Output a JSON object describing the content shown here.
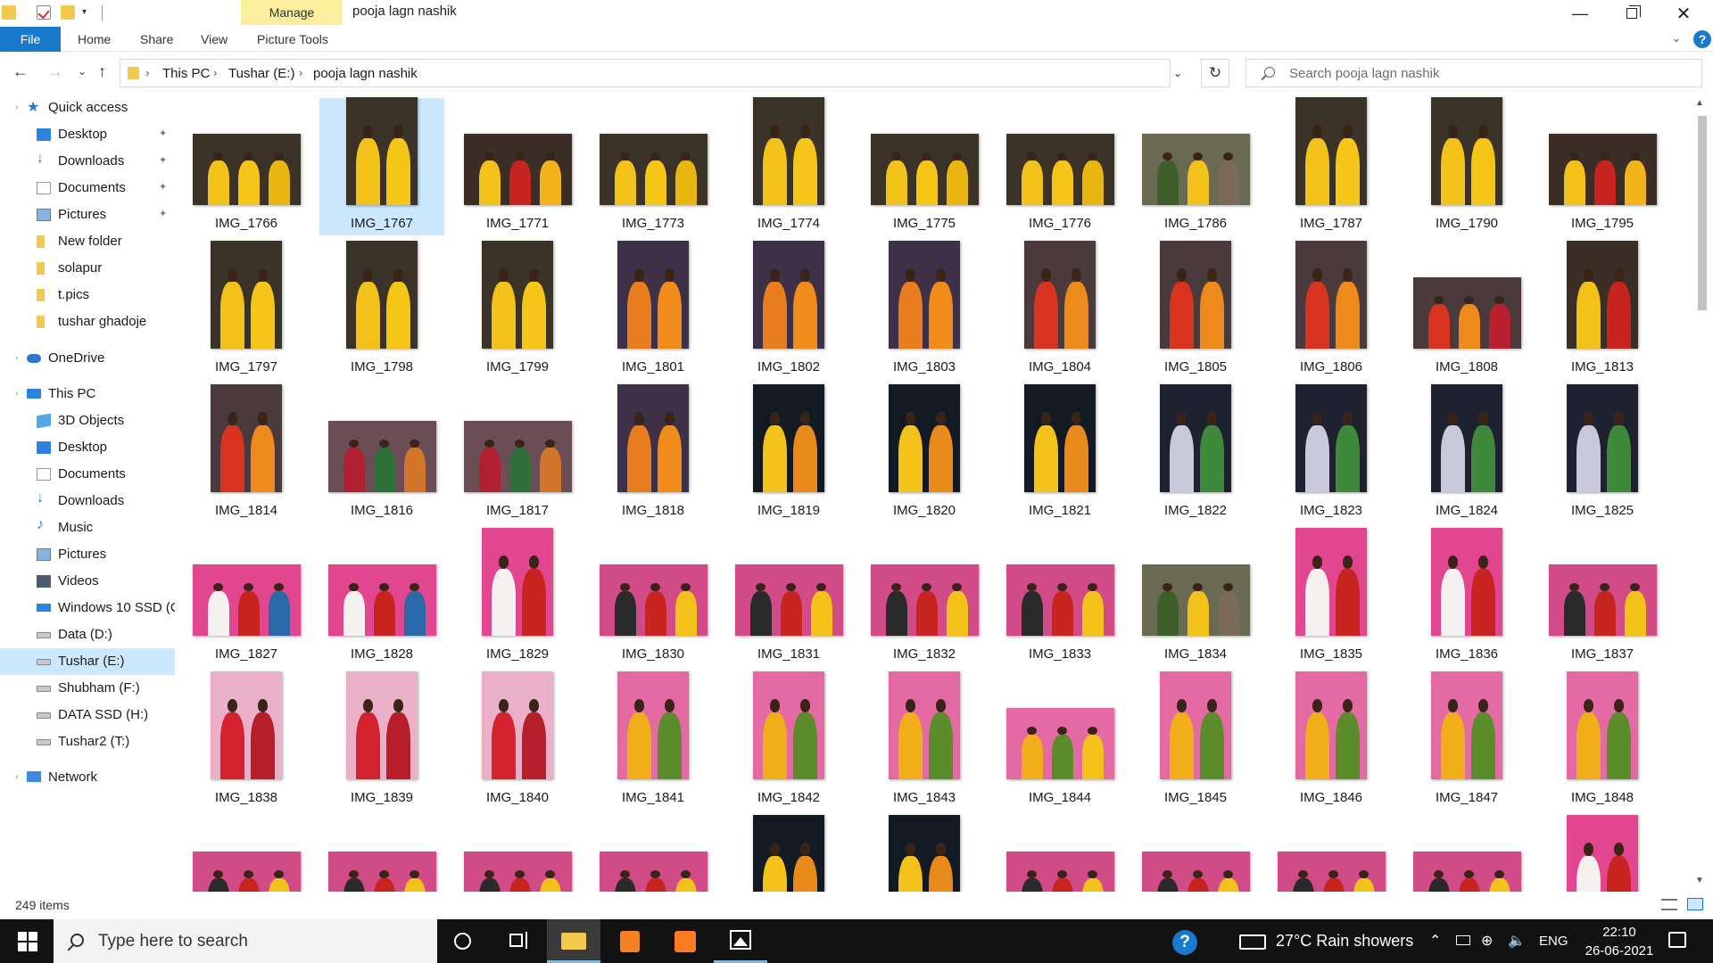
{
  "titlebar": {
    "title": "pooja lagn nashik",
    "manage_tab": "Manage",
    "dropdown_glyph": "▾",
    "minimize_glyph": "—",
    "close_glyph": "✕"
  },
  "ribbon": {
    "file": "File",
    "tabs": [
      "Home",
      "Share",
      "View",
      "Picture Tools"
    ],
    "expand_glyph": "⌄",
    "help_glyph": "?"
  },
  "nav": {
    "back_glyph": "←",
    "forward_glyph": "→",
    "recent_glyph": "⌄",
    "up_glyph": "↑",
    "breadcrumb_sep": "›",
    "breadcrumbs": [
      "This PC",
      "Tushar (E:)",
      "pooja lagn nashik"
    ],
    "dropdown_glyph": "⌄",
    "refresh_glyph": "↻",
    "search_placeholder": "Search pooja lagn nashik"
  },
  "sidebar": {
    "pin_glyph": "📌",
    "caret_glyph": "›",
    "items": [
      {
        "label": "Quick access",
        "icon": "star-icon"
      },
      {
        "label": "Desktop",
        "icon": "desktop-icon",
        "pinned": true
      },
      {
        "label": "Downloads",
        "icon": "download-icon",
        "pinned": true
      },
      {
        "label": "Documents",
        "icon": "documents-icon",
        "pinned": true
      },
      {
        "label": "Pictures",
        "icon": "pictures-icon",
        "pinned": true
      },
      {
        "label": "New folder",
        "icon": "folder-icon"
      },
      {
        "label": "solapur",
        "icon": "folder-icon"
      },
      {
        "label": "t.pics",
        "icon": "folder-icon"
      },
      {
        "label": "tushar ghadoje",
        "icon": "folder-icon"
      },
      {
        "label": "OneDrive",
        "icon": "cloud-icon"
      },
      {
        "label": "This PC",
        "icon": "computer-icon"
      },
      {
        "label": "3D Objects",
        "icon": "3d-objects-icon"
      },
      {
        "label": "Desktop",
        "icon": "desktop-icon"
      },
      {
        "label": "Documents",
        "icon": "documents-icon"
      },
      {
        "label": "Downloads",
        "icon": "download-icon"
      },
      {
        "label": "Music",
        "icon": "music-icon"
      },
      {
        "label": "Pictures",
        "icon": "pictures-icon"
      },
      {
        "label": "Videos",
        "icon": "videos-icon"
      },
      {
        "label": "Windows 10 SSD (C",
        "icon": "windows-drive-icon"
      },
      {
        "label": "Data (D:)",
        "icon": "drive-icon"
      },
      {
        "label": "Tushar (E:)",
        "icon": "drive-icon",
        "selected": true
      },
      {
        "label": "Shubham (F:)",
        "icon": "drive-icon"
      },
      {
        "label": "DATA SSD (H:)",
        "icon": "drive-icon"
      },
      {
        "label": "Tushar2 (T:)",
        "icon": "drive-icon"
      },
      {
        "label": "Network",
        "icon": "network-icon"
      }
    ]
  },
  "files": {
    "items": [
      {
        "name": "IMG_1766",
        "orient": "land",
        "scene": "yellow"
      },
      {
        "name": "IMG_1767",
        "orient": "port",
        "scene": "yellow",
        "selected": true
      },
      {
        "name": "IMG_1771",
        "orient": "land",
        "scene": "yellowred"
      },
      {
        "name": "IMG_1773",
        "orient": "land",
        "scene": "yellow"
      },
      {
        "name": "IMG_1774",
        "orient": "port",
        "scene": "yellow"
      },
      {
        "name": "IMG_1775",
        "orient": "land",
        "scene": "yellow"
      },
      {
        "name": "IMG_1776",
        "orient": "land",
        "scene": "yellow"
      },
      {
        "name": "IMG_1786",
        "orient": "land",
        "scene": "garden"
      },
      {
        "name": "IMG_1787",
        "orient": "port",
        "scene": "yellow"
      },
      {
        "name": "IMG_1790",
        "orient": "port",
        "scene": "yellow"
      },
      {
        "name": "IMG_1795",
        "orient": "land",
        "scene": "yellowred"
      },
      {
        "name": "IMG_1797",
        "orient": "port",
        "scene": "yellow"
      },
      {
        "name": "IMG_1798",
        "orient": "port",
        "scene": "yellow"
      },
      {
        "name": "IMG_1799",
        "orient": "port",
        "scene": "yellow"
      },
      {
        "name": "IMG_1801",
        "orient": "port",
        "scene": "orange"
      },
      {
        "name": "IMG_1802",
        "orient": "port",
        "scene": "orange"
      },
      {
        "name": "IMG_1803",
        "orient": "port",
        "scene": "orange"
      },
      {
        "name": "IMG_1804",
        "orient": "port",
        "scene": "orangered"
      },
      {
        "name": "IMG_1805",
        "orient": "port",
        "scene": "orangered"
      },
      {
        "name": "IMG_1806",
        "orient": "port",
        "scene": "orangered"
      },
      {
        "name": "IMG_1808",
        "orient": "land",
        "scene": "orangered"
      },
      {
        "name": "IMG_1813",
        "orient": "port",
        "scene": "yellowred"
      },
      {
        "name": "IMG_1814",
        "orient": "port",
        "scene": "orangered"
      },
      {
        "name": "IMG_1816",
        "orient": "land",
        "scene": "group"
      },
      {
        "name": "IMG_1817",
        "orient": "land",
        "scene": "group"
      },
      {
        "name": "IMG_1818",
        "orient": "port",
        "scene": "orange"
      },
      {
        "name": "IMG_1819",
        "orient": "port",
        "scene": "night"
      },
      {
        "name": "IMG_1820",
        "orient": "port",
        "scene": "night"
      },
      {
        "name": "IMG_1821",
        "orient": "port",
        "scene": "night"
      },
      {
        "name": "IMG_1822",
        "orient": "port",
        "scene": "fountain"
      },
      {
        "name": "IMG_1823",
        "orient": "port",
        "scene": "fountain"
      },
      {
        "name": "IMG_1824",
        "orient": "port",
        "scene": "fountain"
      },
      {
        "name": "IMG_1825",
        "orient": "port",
        "scene": "fountain"
      },
      {
        "name": "IMG_1827",
        "orient": "land",
        "scene": "pink"
      },
      {
        "name": "IMG_1828",
        "orient": "land",
        "scene": "pink"
      },
      {
        "name": "IMG_1829",
        "orient": "port",
        "scene": "pink"
      },
      {
        "name": "IMG_1830",
        "orient": "land",
        "scene": "pinkgroup"
      },
      {
        "name": "IMG_1831",
        "orient": "land",
        "scene": "pinkgroup"
      },
      {
        "name": "IMG_1832",
        "orient": "land",
        "scene": "pinkgroup"
      },
      {
        "name": "IMG_1833",
        "orient": "land",
        "scene": "pinkgroup"
      },
      {
        "name": "IMG_1834",
        "orient": "land",
        "scene": "garden"
      },
      {
        "name": "IMG_1835",
        "orient": "port",
        "scene": "pink"
      },
      {
        "name": "IMG_1836",
        "orient": "port",
        "scene": "pink"
      },
      {
        "name": "IMG_1837",
        "orient": "land",
        "scene": "pinkgroup"
      },
      {
        "name": "IMG_1838",
        "orient": "port",
        "scene": "pinkred"
      },
      {
        "name": "IMG_1839",
        "orient": "port",
        "scene": "pinkred"
      },
      {
        "name": "IMG_1840",
        "orient": "port",
        "scene": "pinkred"
      },
      {
        "name": "IMG_1841",
        "orient": "port",
        "scene": "pinkyellow"
      },
      {
        "name": "IMG_1842",
        "orient": "port",
        "scene": "pinkyellow"
      },
      {
        "name": "IMG_1843",
        "orient": "port",
        "scene": "pinkyellow"
      },
      {
        "name": "IMG_1844",
        "orient": "land",
        "scene": "pinkyellow"
      },
      {
        "name": "IMG_1845",
        "orient": "port",
        "scene": "pinkyellow"
      },
      {
        "name": "IMG_1846",
        "orient": "port",
        "scene": "pinkyellow"
      },
      {
        "name": "IMG_1847",
        "orient": "port",
        "scene": "pinkyellow"
      },
      {
        "name": "IMG_1848",
        "orient": "port",
        "scene": "pinkyellow"
      },
      {
        "name": "",
        "orient": "land",
        "scene": "pinkgroup"
      },
      {
        "name": "",
        "orient": "land",
        "scene": "pinkgroup"
      },
      {
        "name": "",
        "orient": "land",
        "scene": "pinkgroup"
      },
      {
        "name": "",
        "orient": "land",
        "scene": "pinkgroup"
      },
      {
        "name": "",
        "orient": "port",
        "scene": "night"
      },
      {
        "name": "",
        "orient": "port",
        "scene": "night"
      },
      {
        "name": "",
        "orient": "land",
        "scene": "pinkgroup"
      },
      {
        "name": "",
        "orient": "land",
        "scene": "pinkgroup"
      },
      {
        "name": "",
        "orient": "land",
        "scene": "pinkgroup"
      },
      {
        "name": "",
        "orient": "land",
        "scene": "pinkgroup"
      },
      {
        "name": "",
        "orient": "port",
        "scene": "pink"
      }
    ]
  },
  "scene_colors": {
    "yellow": {
      "bg": "#3b3228",
      "fig": [
        "#f2c21b",
        "#f5c518",
        "#e8b511"
      ]
    },
    "yellowred": {
      "bg": "#3a2e26",
      "fig": [
        "#f2c21b",
        "#c8241f",
        "#f2b21a"
      ]
    },
    "orange": {
      "bg": "#3e3046",
      "fig": [
        "#e77d1f",
        "#f08c1a",
        "#d24c1c"
      ]
    },
    "orangered": {
      "bg": "#4a3a3c",
      "fig": [
        "#d8331f",
        "#ec8a1c",
        "#b91f2e"
      ]
    },
    "group": {
      "bg": "#6b4d55",
      "fig": [
        "#b02030",
        "#2e6f3a",
        "#d0752a"
      ]
    },
    "night": {
      "bg": "#141a24",
      "fig": [
        "#f2c21b",
        "#e98a1d",
        "#d9c9a0"
      ]
    },
    "fountain": {
      "bg": "#1e2230",
      "fig": [
        "#c8c8d8",
        "#3f8a3a",
        "#c8241f"
      ]
    },
    "garden": {
      "bg": "#6a6a52",
      "fig": [
        "#3e5e2a",
        "#f2c21b",
        "#7a6a5a"
      ]
    },
    "pink": {
      "bg": "#e2468f",
      "fig": [
        "#f4f0f0",
        "#c8241f",
        "#2a6aa8"
      ]
    },
    "pinkgroup": {
      "bg": "#d14b86",
      "fig": [
        "#2a2a2a",
        "#c8241f",
        "#f2c21b"
      ]
    },
    "pinkred": {
      "bg": "#e9b0c8",
      "fig": [
        "#d2232f",
        "#b81d2a",
        "#e0404a"
      ]
    },
    "pinkyellow": {
      "bg": "#e36aa3",
      "fig": [
        "#f1ad1a",
        "#5a8d2a",
        "#f2c21b"
      ]
    }
  },
  "status": {
    "count": "249 items"
  },
  "taskbar": {
    "search_text": "Type here to search",
    "weather": "27°C  Rain showers",
    "tray_chevron": "⌃",
    "tray_network": "⊕",
    "tray_volume": "🔈",
    "lang": "ENG",
    "time": "22:10",
    "date": "26-06-2021",
    "help_glyph": "?"
  }
}
